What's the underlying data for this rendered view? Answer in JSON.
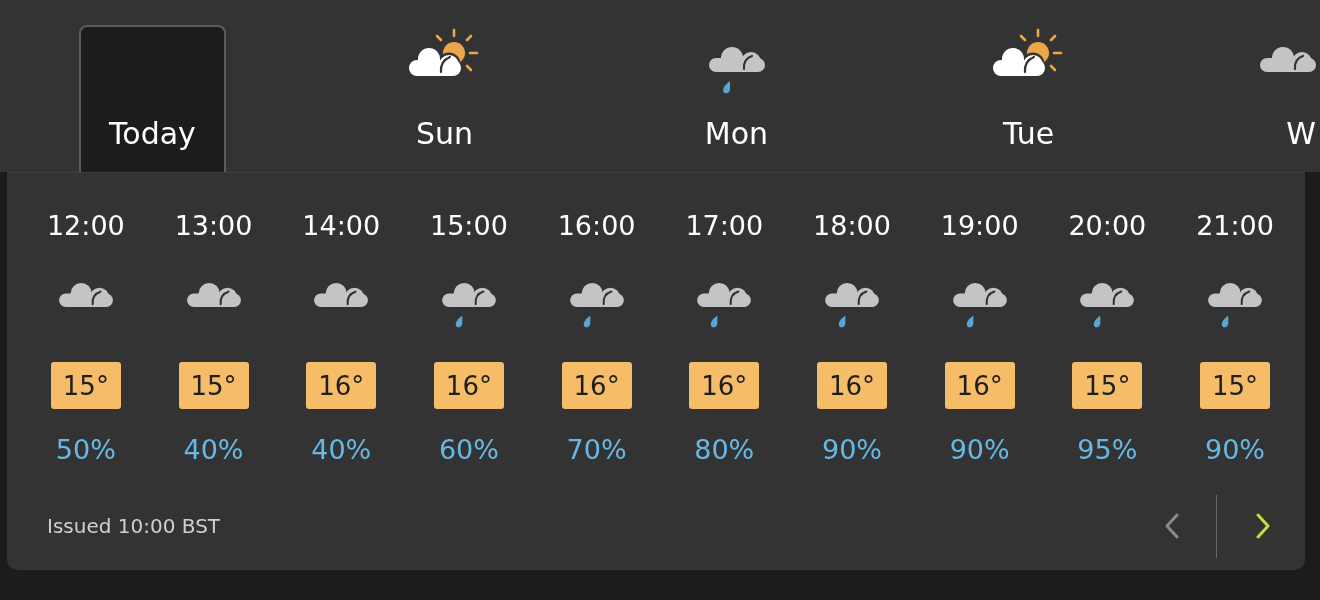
{
  "days": [
    {
      "label": "Today",
      "selected": true
    },
    {
      "label": "Sun",
      "selected": false,
      "kind": "partly"
    },
    {
      "label": "Mon",
      "selected": false,
      "kind": "rain"
    },
    {
      "label": "Tue",
      "selected": false,
      "kind": "partly"
    },
    {
      "label": "W",
      "selected": false,
      "kind": "cloud"
    }
  ],
  "hours": [
    {
      "time": "12:00",
      "kind": "cloud",
      "temperature": "15°",
      "rain_chance": "50%"
    },
    {
      "time": "13:00",
      "kind": "cloud",
      "temperature": "15°",
      "rain_chance": "40%"
    },
    {
      "time": "14:00",
      "kind": "cloud",
      "temperature": "16°",
      "rain_chance": "40%"
    },
    {
      "time": "15:00",
      "kind": "rain",
      "temperature": "16°",
      "rain_chance": "60%"
    },
    {
      "time": "16:00",
      "kind": "rain",
      "temperature": "16°",
      "rain_chance": "70%"
    },
    {
      "time": "17:00",
      "kind": "rain",
      "temperature": "16°",
      "rain_chance": "80%"
    },
    {
      "time": "18:00",
      "kind": "rain",
      "temperature": "16°",
      "rain_chance": "90%"
    },
    {
      "time": "19:00",
      "kind": "rain",
      "temperature": "16°",
      "rain_chance": "90%"
    },
    {
      "time": "20:00",
      "kind": "rain",
      "temperature": "15°",
      "rain_chance": "95%"
    },
    {
      "time": "21:00",
      "kind": "rain",
      "temperature": "15°",
      "rain_chance": "90%"
    }
  ],
  "footer": {
    "issued": "Issued 10:00 BST",
    "buttons": [
      {
        "kind": "previous",
        "disabled": true
      },
      {
        "kind": "next",
        "disabled": false
      }
    ]
  }
}
